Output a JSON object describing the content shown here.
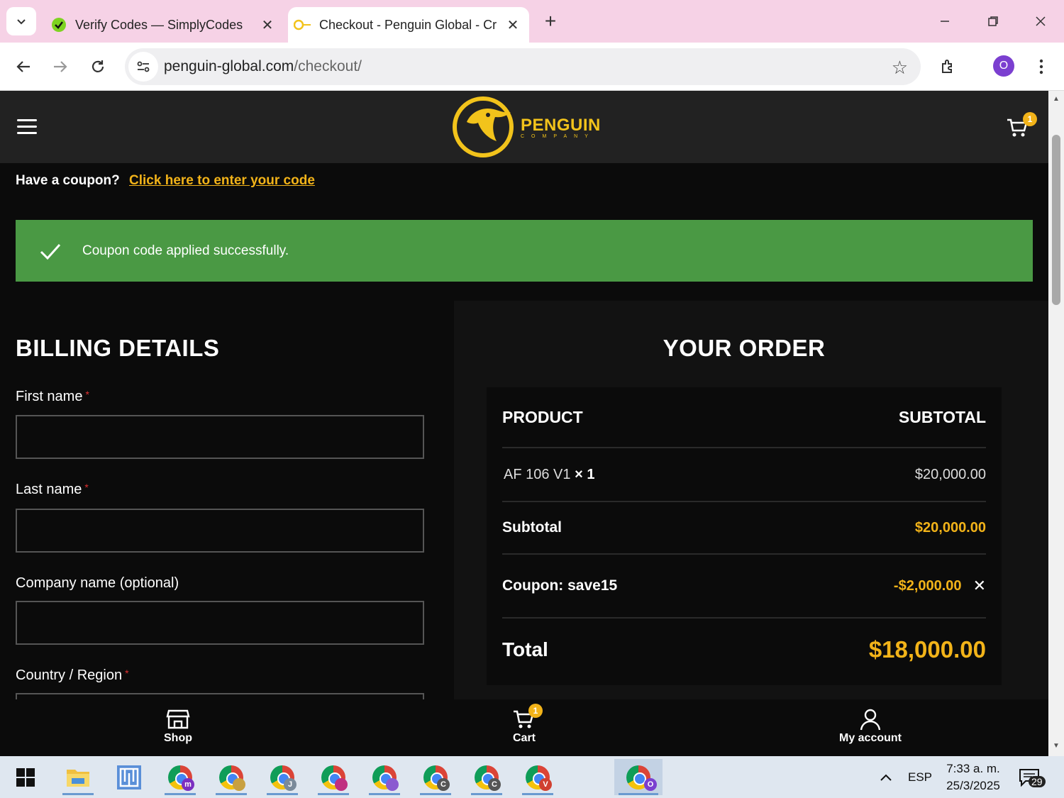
{
  "browser": {
    "tabs": [
      {
        "title": "Verify Codes — SimplyCodes",
        "active": false
      },
      {
        "title": "Checkout - Penguin Global - Cr",
        "active": true
      }
    ],
    "url_host": "penguin-global.com",
    "url_path": "/checkout/",
    "profile_initial": "O"
  },
  "header": {
    "logo_main": "PENGUIN",
    "logo_sub": "COMPANY",
    "cart_count": "1"
  },
  "coupon": {
    "prompt": "Have a coupon?",
    "link": "Click here to enter your code",
    "success_message": "Coupon code applied successfully."
  },
  "billing": {
    "title": "BILLING DETAILS",
    "fields": [
      {
        "label": "First name",
        "required": "*"
      },
      {
        "label": "Last name",
        "required": "*"
      },
      {
        "label": "Company name (optional)",
        "required": ""
      },
      {
        "label": "Country / Region",
        "required": "*"
      }
    ]
  },
  "order": {
    "title": "YOUR ORDER",
    "col_product": "PRODUCT",
    "col_subtotal": "SUBTOTAL",
    "item_name": "AF 106 V1",
    "item_qty": "× 1",
    "item_price": "$20,000.00",
    "subtotal_label": "Subtotal",
    "subtotal_value": "$20,000.00",
    "coupon_label": "Coupon: save15",
    "coupon_value": "-$2,000.00",
    "total_label": "Total",
    "total_value": "$18,000.00"
  },
  "bottom_nav": {
    "shop": "Shop",
    "cart": "Cart",
    "cart_count": "1",
    "account": "My account"
  },
  "taskbar": {
    "apps": [
      {
        "badge": "m",
        "color": "#7b2fc0"
      },
      {
        "badge": "",
        "color": "#c8a040"
      },
      {
        "badge": "J",
        "color": "#7a8a9a"
      },
      {
        "badge": "",
        "color": "#c03080"
      },
      {
        "badge": "",
        "color": "#8a5ad0"
      },
      {
        "badge": "C",
        "color": "#555555"
      },
      {
        "badge": "C",
        "color": "#555555"
      },
      {
        "badge": "V",
        "color": "#d04030"
      },
      {
        "badge": "O",
        "color": "#7b3fd0"
      }
    ],
    "language": "ESP",
    "time": "7:33 a. m.",
    "date": "25/3/2025",
    "notifications": "29"
  },
  "colors": {
    "accent": "#f2b319",
    "success": "#4a9944",
    "tab_strip": "#f6d2e6"
  }
}
